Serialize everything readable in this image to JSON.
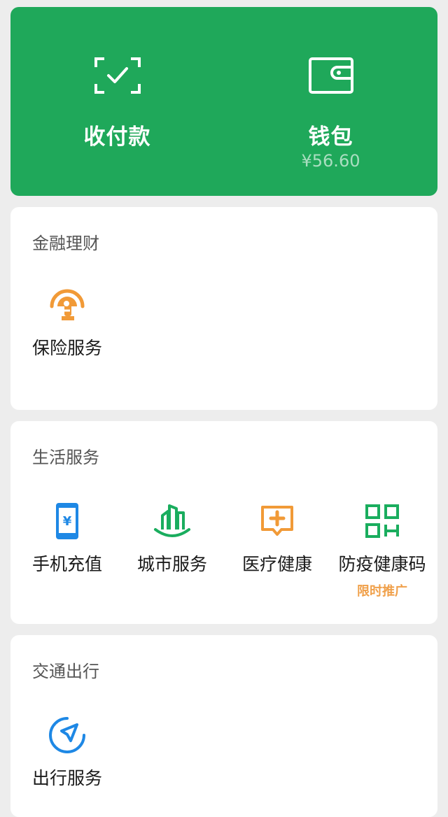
{
  "hero": {
    "pay": {
      "label": "收付款",
      "icon": "scan-check-icon"
    },
    "wallet": {
      "label": "钱包",
      "balance": "¥56.60",
      "icon": "wallet-icon"
    }
  },
  "sections": {
    "finance": {
      "title": "金融理财",
      "items": [
        {
          "label": "保险服务",
          "icon": "insurance-umbrella-icon"
        }
      ]
    },
    "life": {
      "title": "生活服务",
      "items": [
        {
          "label": "手机充值",
          "icon": "mobile-recharge-icon"
        },
        {
          "label": "城市服务",
          "icon": "city-buildings-icon"
        },
        {
          "label": "医疗健康",
          "icon": "medical-cross-icon"
        },
        {
          "label": "防疫健康码",
          "icon": "qr-code-icon",
          "tag": "限时推广"
        }
      ]
    },
    "transport": {
      "title": "交通出行",
      "items": [
        {
          "label": "出行服务",
          "icon": "navigation-arrow-icon"
        }
      ]
    }
  },
  "colors": {
    "brand_green": "#1fa85a",
    "orange": "#f19a37",
    "blue": "#1e88e5",
    "green": "#1aad5e"
  }
}
